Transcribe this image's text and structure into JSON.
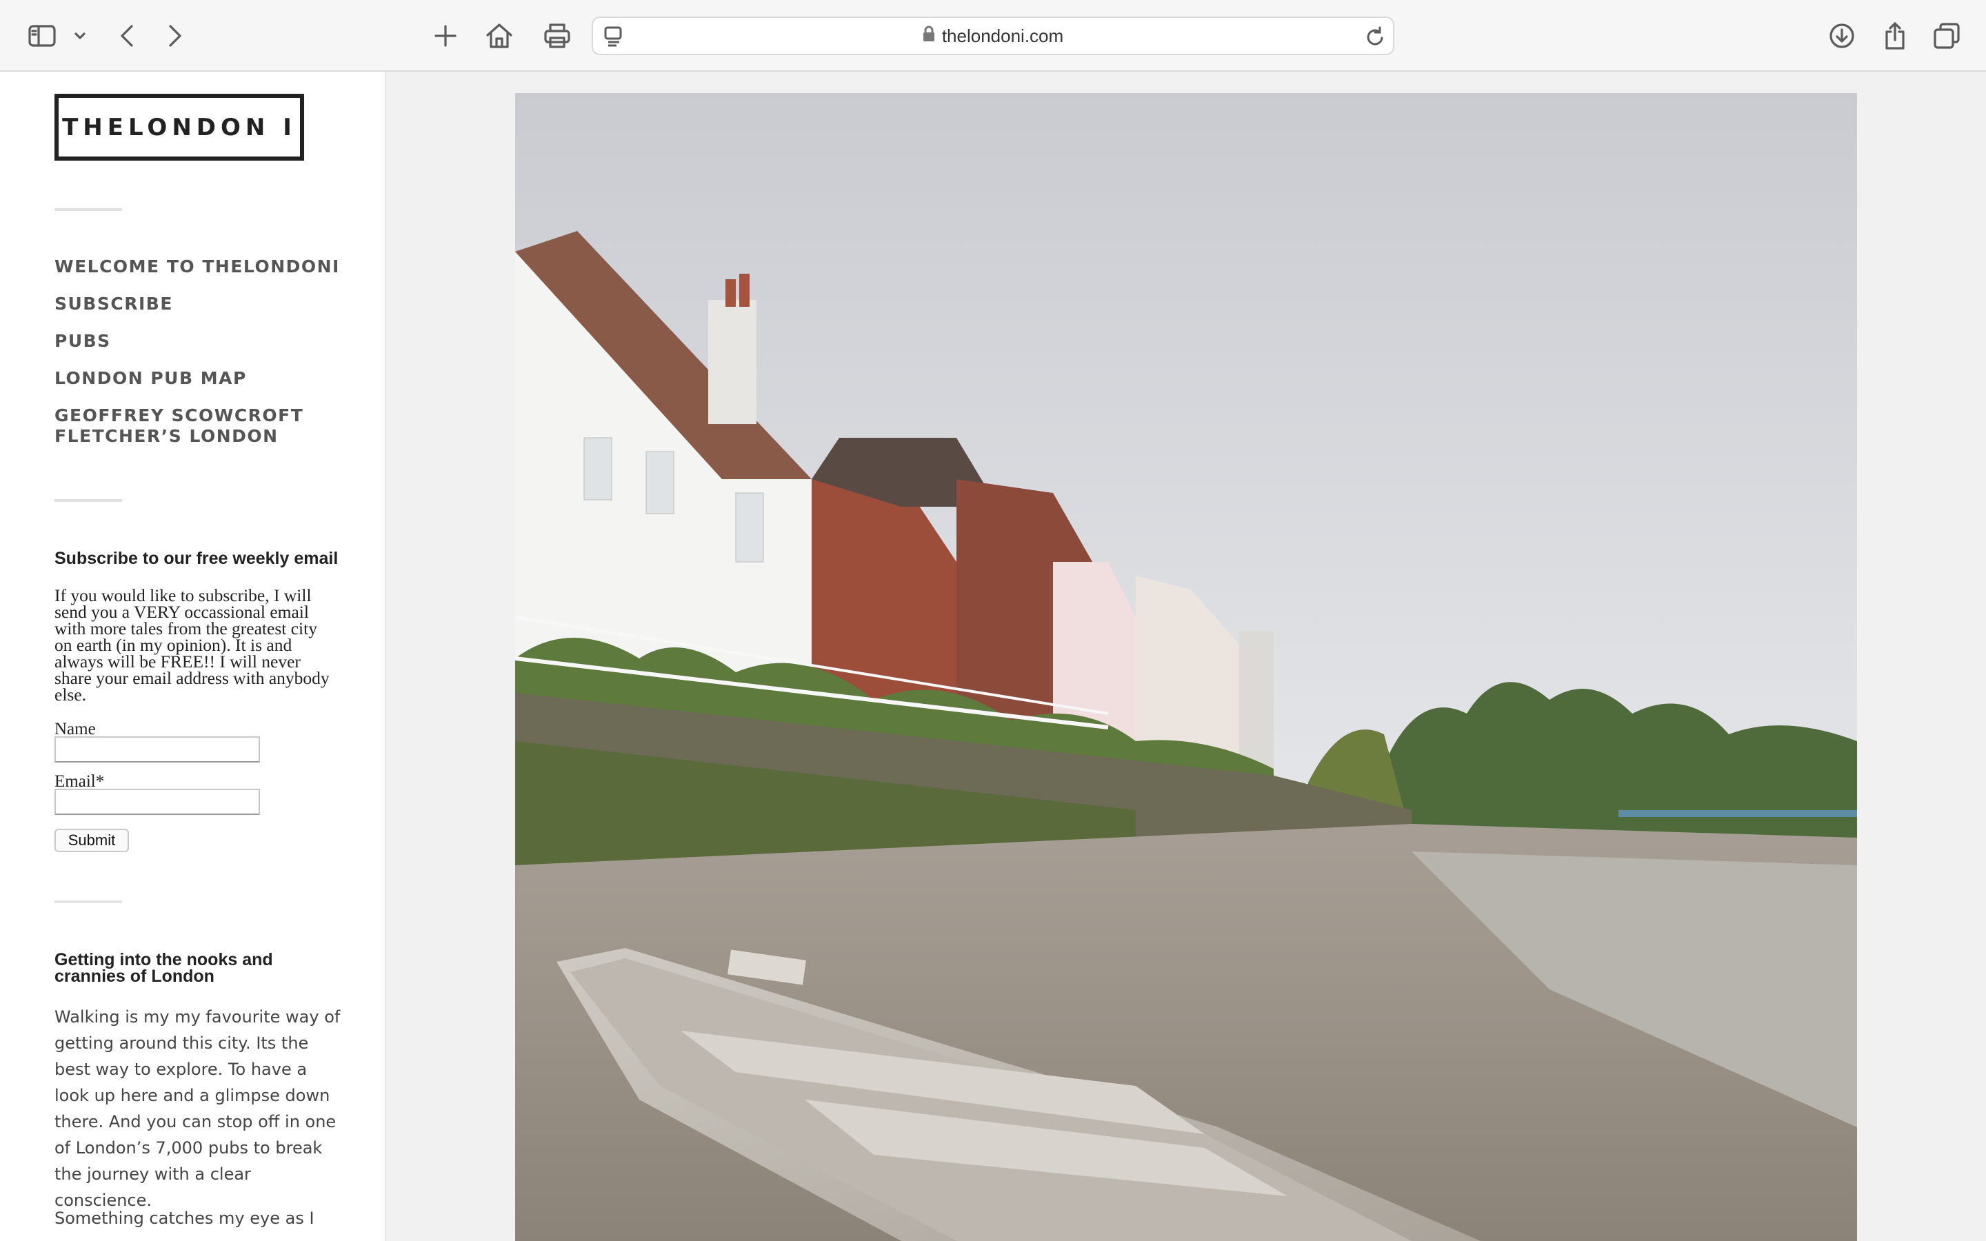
{
  "browser": {
    "url": "thelondoni.com",
    "icons": [
      "sidebar-icon",
      "chevron-down-icon",
      "back-icon",
      "forward-icon",
      "new-tab-icon",
      "home-icon",
      "print-icon",
      "reader-icon",
      "lock-icon",
      "reload-icon",
      "download-icon",
      "share-icon",
      "tabs-icon"
    ]
  },
  "sidebar": {
    "logo": "THELONDON I",
    "nav": [
      "WELCOME TO THELONDONI",
      "SUBSCRIBE",
      "PUBS",
      "LONDON PUB MAP",
      "GEOFFREY SCOWCROFT FLETCHER’S LONDON"
    ],
    "subscribe": {
      "title": "Subscribe to our free weekly email",
      "text": "If you would like to subscribe, I will send you a VERY occassional email with more tales from the greatest city on earth (in my opinion). It is and always will be FREE!! I will never share your email address with anybody else.",
      "name_label": "Name",
      "email_label": "Email*",
      "name_value": "",
      "email_value": "",
      "submit_label": "Submit"
    },
    "nooks": {
      "title": "Getting into the nooks and crannies of London",
      "paragraph1": "Walking is my my favourite way of getting around this city. Its the best way to explore. To have a look up here and a glimpse down there. And you can stop off in one of London’s 7,000 pubs to break the journey with a clear conscience.",
      "paragraph2": "Something catches my eye as I"
    }
  },
  "main": {
    "photo_alt": "Riverside houses at low tide with a small boat on the foreshore"
  },
  "colors": {
    "text": "#222222",
    "nav": "#555555",
    "toolbar": "#f6f6f6",
    "content_bg": "#f1f1f1"
  }
}
